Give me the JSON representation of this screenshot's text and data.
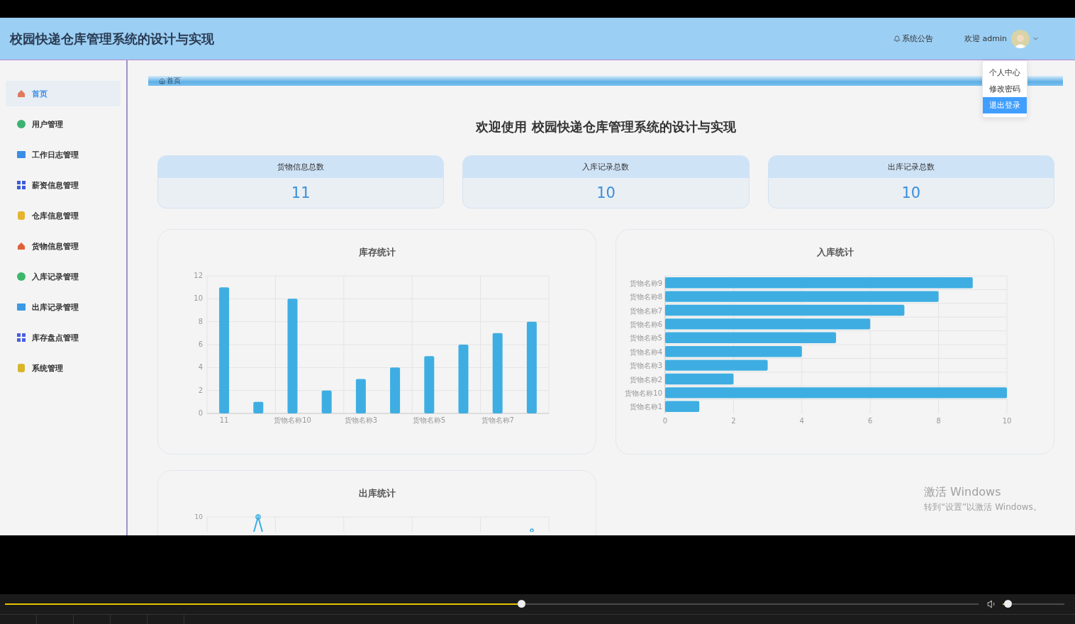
{
  "app": {
    "title": "校园快递仓库管理系统的设计与实现"
  },
  "header": {
    "notice": "系统公告",
    "welcome": "欢迎 admin"
  },
  "user_menu": [
    {
      "label": "个人中心",
      "selected": false
    },
    {
      "label": "修改密码",
      "selected": false
    },
    {
      "label": "退出登录",
      "selected": true
    }
  ],
  "sidebar": {
    "items": [
      {
        "label": "首页",
        "selected": true,
        "color": "#e07a5f"
      },
      {
        "label": "用户管理",
        "selected": false,
        "color": "#3cb371"
      },
      {
        "label": "工作日志管理",
        "selected": false,
        "color": "#3a8ee6"
      },
      {
        "label": "薪资信息管理",
        "selected": false,
        "color": "#3b5bdb"
      },
      {
        "label": "仓库信息管理",
        "selected": false,
        "color": "#e5b530"
      },
      {
        "label": "货物信息管理",
        "selected": false,
        "color": "#e0603a"
      },
      {
        "label": "入库记录管理",
        "selected": false,
        "color": "#3cb86a"
      },
      {
        "label": "出库记录管理",
        "selected": false,
        "color": "#3a9ae6"
      },
      {
        "label": "库存盘点管理",
        "selected": false,
        "color": "#4a5ee0"
      },
      {
        "label": "系统管理",
        "selected": false,
        "color": "#d9b52a"
      }
    ]
  },
  "breadcrumb": [
    "首页"
  ],
  "welcome_title": "欢迎使用 校园快递仓库管理系统的设计与实现",
  "stats": [
    {
      "label": "货物信息总数",
      "value": "11"
    },
    {
      "label": "入库记录总数",
      "value": "10"
    },
    {
      "label": "出库记录总数",
      "value": "10"
    }
  ],
  "charts": [
    {
      "title": "库存统计",
      "chart_data": {
        "type": "bar",
        "categories": [
          "11",
          null,
          "货物名称10",
          null,
          "货物名称3",
          null,
          "货物名称5",
          null,
          "货物名称7",
          null
        ],
        "values": [
          11,
          1,
          10,
          2,
          3,
          4,
          5,
          6,
          7,
          8
        ],
        "ylim": [
          0,
          12
        ],
        "yticks": [
          0,
          2,
          4,
          6,
          8,
          10,
          12
        ],
        "grid": true
      }
    },
    {
      "title": "入库统计",
      "chart_data": {
        "type": "bar",
        "orientation": "horizontal",
        "categories": [
          "货物名称9",
          "货物名称8",
          "货物名称7",
          "货物名称6",
          "货物名称5",
          "货物名称4",
          "货物名称3",
          "货物名称2",
          "货物名称10",
          "货物名称1"
        ],
        "values": [
          9,
          8,
          7,
          6,
          5,
          4,
          3,
          2,
          10,
          1
        ],
        "xlim": [
          0,
          10
        ],
        "xticks": [
          0,
          2,
          4,
          6,
          8,
          10
        ],
        "grid": true
      }
    },
    {
      "title": "出库统计",
      "ytick_label": "10"
    }
  ],
  "os_notice": {
    "title": "激活 Windows",
    "text": "转到“设置”以激活 Windows。"
  },
  "player": {
    "progress": {
      "level": 0.53
    },
    "volume": {
      "level": 0.08
    }
  }
}
